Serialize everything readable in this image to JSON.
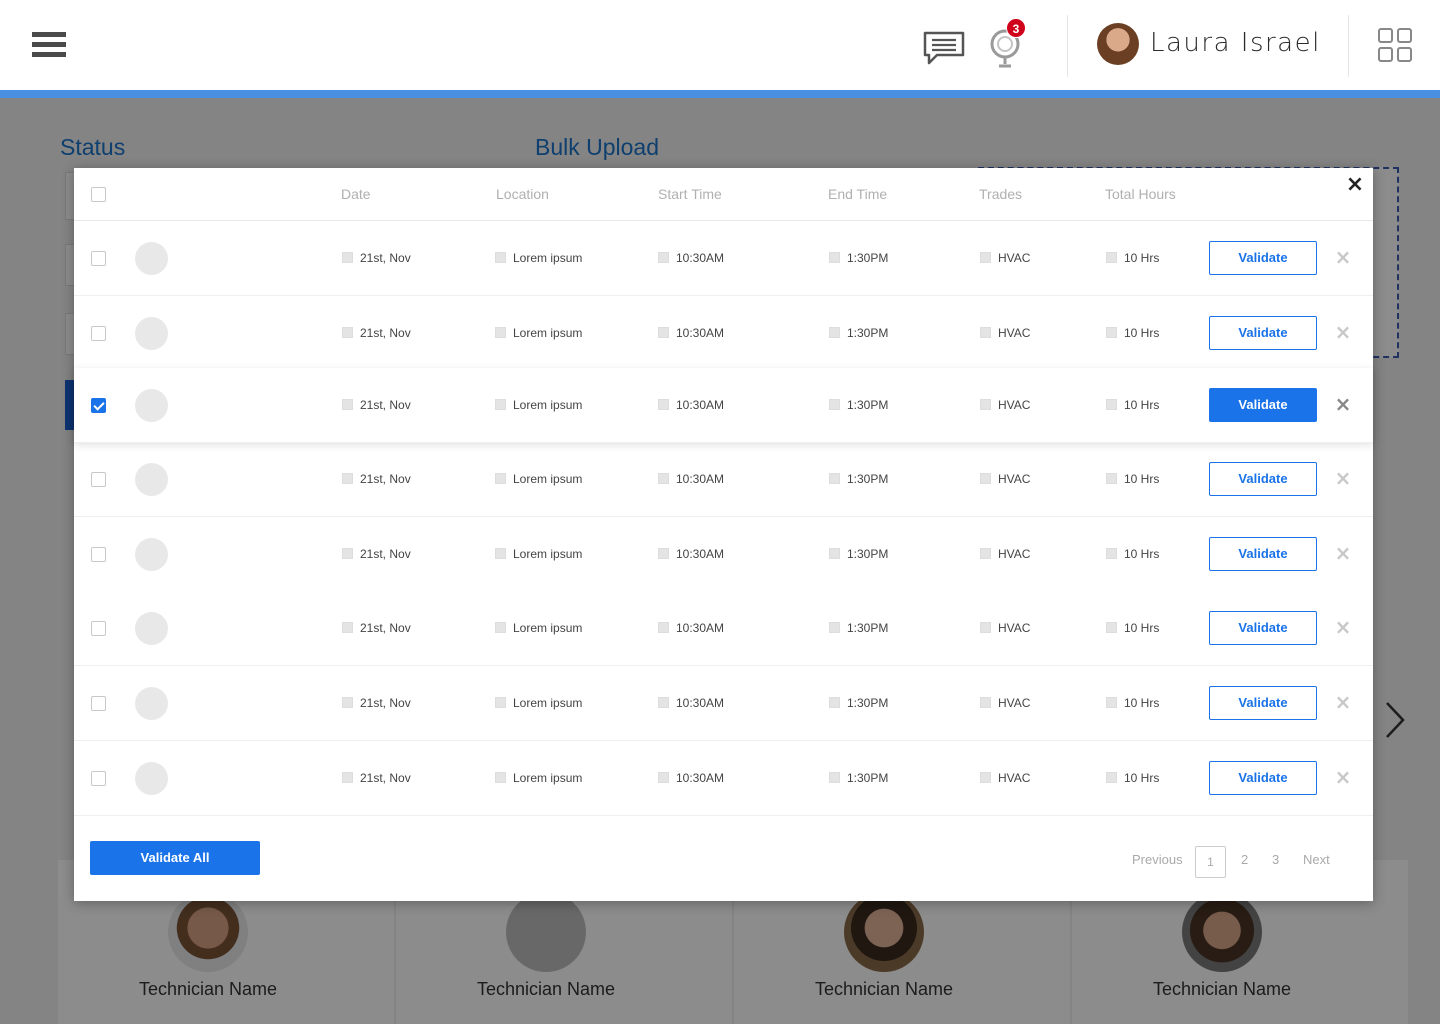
{
  "header": {
    "user_name": "Laura Israel",
    "notification_count": "3"
  },
  "background": {
    "status_title": "Status",
    "bulk_upload_title": "Bulk Upload",
    "technicians": [
      "Technician Name",
      "Technician Name",
      "Technician Name",
      "Technician Name"
    ]
  },
  "modal": {
    "columns": {
      "date": "Date",
      "location": "Location",
      "start_time": "Start Time",
      "end_time": "End Time",
      "trades": "Trades",
      "total_hours": "Total Hours"
    },
    "close_symbol": "×",
    "rows": [
      {
        "checked": false,
        "date": "21st, Nov",
        "location": "Lorem ipsum",
        "start": "10:30AM",
        "end": "1:30PM",
        "trade": "HVAC",
        "hours": "10 Hrs",
        "action": "Validate"
      },
      {
        "checked": false,
        "date": "21st, Nov",
        "location": "Lorem ipsum",
        "start": "10:30AM",
        "end": "1:30PM",
        "trade": "HVAC",
        "hours": "10 Hrs",
        "action": "Validate"
      },
      {
        "checked": true,
        "date": "21st, Nov",
        "location": "Lorem ipsum",
        "start": "10:30AM",
        "end": "1:30PM",
        "trade": "HVAC",
        "hours": "10 Hrs",
        "action": "Validate"
      },
      {
        "checked": false,
        "date": "21st, Nov",
        "location": "Lorem ipsum",
        "start": "10:30AM",
        "end": "1:30PM",
        "trade": "HVAC",
        "hours": "10 Hrs",
        "action": "Validate"
      },
      {
        "checked": false,
        "date": "21st, Nov",
        "location": "Lorem ipsum",
        "start": "10:30AM",
        "end": "1:30PM",
        "trade": "HVAC",
        "hours": "10 Hrs",
        "action": "Validate"
      },
      {
        "checked": false,
        "date": "21st, Nov",
        "location": "Lorem ipsum",
        "start": "10:30AM",
        "end": "1:30PM",
        "trade": "HVAC",
        "hours": "10 Hrs",
        "action": "Validate"
      },
      {
        "checked": false,
        "date": "21st, Nov",
        "location": "Lorem ipsum",
        "start": "10:30AM",
        "end": "1:30PM",
        "trade": "HVAC",
        "hours": "10 Hrs",
        "action": "Validate"
      },
      {
        "checked": false,
        "date": "21st, Nov",
        "location": "Lorem ipsum",
        "start": "10:30AM",
        "end": "1:30PM",
        "trade": "HVAC",
        "hours": "10 Hrs",
        "action": "Validate"
      }
    ],
    "validate_all_label": "Validate All",
    "pagination": {
      "previous": "Previous",
      "pages": [
        "1",
        "2",
        "3"
      ],
      "current": "1",
      "next": "Next"
    }
  },
  "colors": {
    "accent": "#1a73e8",
    "header_stripe": "#4a90e2",
    "section_title": "#1a73c8",
    "badge": "#d0021b"
  }
}
